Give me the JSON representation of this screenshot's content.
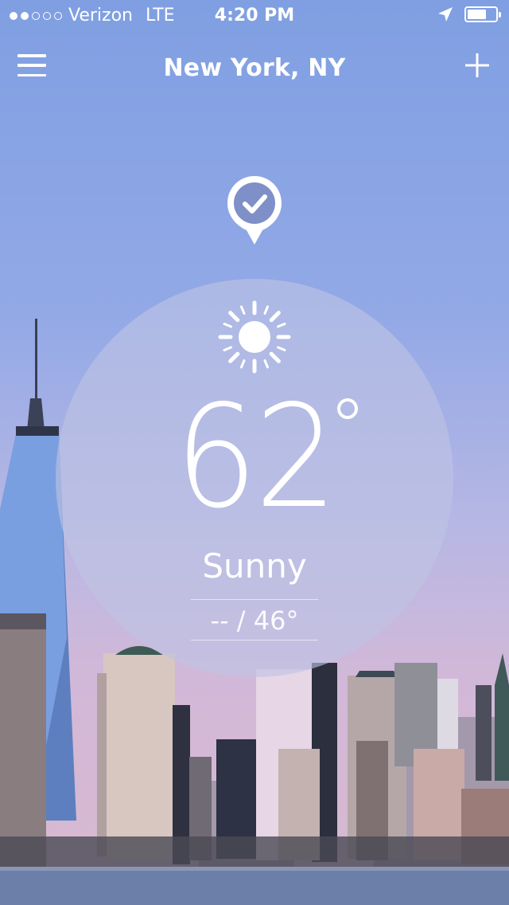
{
  "status_bar": {
    "carrier": "Verizon",
    "network": "LTE",
    "time": "4:20 PM",
    "signal_filled": 2,
    "signal_total": 5,
    "battery_level": 0.7
  },
  "nav": {
    "title": "New York, NY",
    "menu_icon": "hamburger-icon",
    "add_icon": "plus-icon"
  },
  "location_marker_icon": "location-check-icon",
  "weather": {
    "icon": "sun-icon",
    "temperature": "62",
    "condition": "Sunny",
    "high_low": "-- / 46°"
  }
}
